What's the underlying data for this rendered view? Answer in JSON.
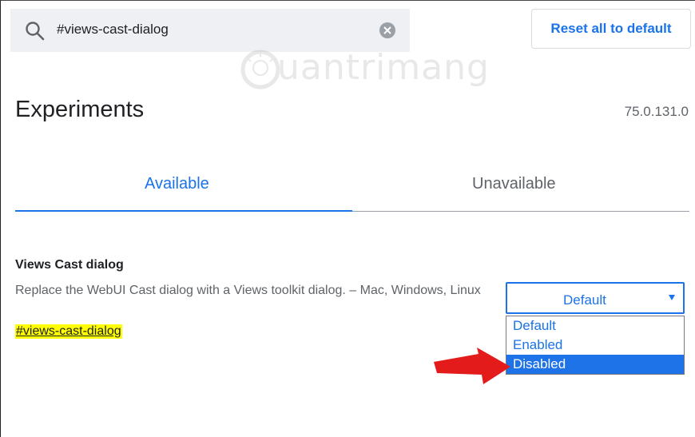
{
  "search": {
    "query": "#views-cast-dialog"
  },
  "header": {
    "reset_label": "Reset all to default"
  },
  "watermark": {
    "text": "uantrimang"
  },
  "page": {
    "title": "Experiments",
    "version": "75.0.131.0"
  },
  "tabs": [
    {
      "label": "Available",
      "active": true
    },
    {
      "label": "Unavailable",
      "active": false
    }
  ],
  "experiment": {
    "title": "Views Cast dialog",
    "description": "Replace the WebUI Cast dialog with a Views toolkit dialog. – Mac, Windows, Linux",
    "link": "#views-cast-dialog",
    "select": {
      "value": "Default",
      "options": [
        {
          "label": "Default",
          "selected": false
        },
        {
          "label": "Enabled",
          "selected": false
        },
        {
          "label": "Disabled",
          "selected": true
        }
      ]
    }
  },
  "colors": {
    "accent": "#1a73e8",
    "highlight": "#ffff00",
    "arrow": "#e31b1b"
  }
}
